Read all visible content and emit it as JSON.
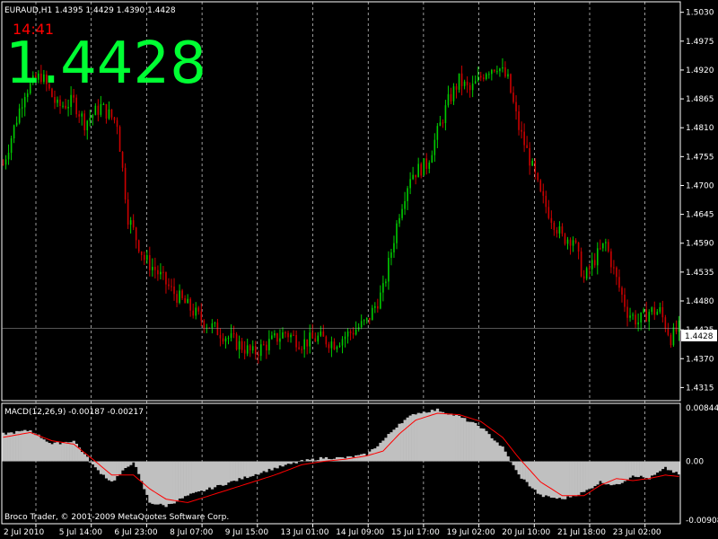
{
  "header": {
    "ohlc_label": "EURAUD,H1  1.4395 1.4429 1.4390 1.4428",
    "clock": "14:41",
    "big_price": "1.4428",
    "current_price_tag": "1.4428"
  },
  "footer": {
    "copyright": "Broco Trader, © 2001-2009 MetaQuotes Software Corp."
  },
  "colors": {
    "background": "#000000",
    "bull": "#00cc00",
    "bear": "#cc0000",
    "macd_hist": "#c0c0c0",
    "signal": "#ff0000",
    "big_price": "#00ff33",
    "clock": "#ff0000",
    "grid": "#ffffff"
  },
  "chart_data": [
    {
      "type": "candlestick",
      "symbol": "EURAUD",
      "timeframe": "H1",
      "ylim": [
        1.429,
        1.505
      ],
      "y_ticks": [
        "1.5030",
        "1.4975",
        "1.4920",
        "1.4865",
        "1.4810",
        "1.4755",
        "1.4700",
        "1.4645",
        "1.4590",
        "1.4535",
        "1.4480",
        "1.4425",
        "1.4370",
        "1.4315"
      ],
      "x_ticks": [
        "2 Jul 2010",
        "5 Jul 14:00",
        "6 Jul 23:00",
        "8 Jul 07:00",
        "9 Jul 15:00",
        "13 Jul 01:00",
        "14 Jul 09:00",
        "15 Jul 17:00",
        "19 Jul 02:00",
        "20 Jul 10:00",
        "21 Jul 18:00",
        "23 Jul 02:00"
      ],
      "current_price": 1.4428,
      "close_path": [
        [
          0,
          1.474
        ],
        [
          8,
          1.488
        ],
        [
          14,
          1.491
        ],
        [
          20,
          1.485
        ],
        [
          26,
          1.486
        ],
        [
          30,
          1.482
        ],
        [
          36,
          1.485
        ],
        [
          42,
          1.482
        ],
        [
          46,
          1.464
        ],
        [
          52,
          1.456
        ],
        [
          56,
          1.454
        ],
        [
          62,
          1.45
        ],
        [
          68,
          1.447
        ],
        [
          74,
          1.444
        ],
        [
          80,
          1.442
        ],
        [
          86,
          1.44
        ],
        [
          92,
          1.438
        ],
        [
          98,
          1.44
        ],
        [
          104,
          1.442
        ],
        [
          110,
          1.44
        ],
        [
          116,
          1.441
        ],
        [
          122,
          1.44
        ],
        [
          128,
          1.442
        ],
        [
          134,
          1.444
        ],
        [
          140,
          1.45
        ],
        [
          146,
          1.465
        ],
        [
          150,
          1.472
        ],
        [
          156,
          1.474
        ],
        [
          160,
          1.48
        ],
        [
          164,
          1.486
        ],
        [
          168,
          1.49
        ],
        [
          172,
          1.488
        ],
        [
          178,
          1.492
        ],
        [
          182,
          1.493
        ],
        [
          186,
          1.49
        ],
        [
          190,
          1.481
        ],
        [
          194,
          1.475
        ],
        [
          198,
          1.468
        ],
        [
          202,
          1.464
        ],
        [
          206,
          1.46
        ],
        [
          210,
          1.46
        ],
        [
          214,
          1.452
        ],
        [
          218,
          1.456
        ],
        [
          222,
          1.459
        ],
        [
          226,
          1.452
        ],
        [
          230,
          1.446
        ],
        [
          234,
          1.444
        ],
        [
          238,
          1.446
        ],
        [
          242,
          1.446
        ],
        [
          246,
          1.441
        ],
        [
          249,
          1.4428
        ]
      ],
      "bars": 250
    },
    {
      "type": "macd",
      "label": "MACD(12,26,9) -0.00187 -0.00217",
      "ylim": [
        -0.00908,
        0.00844
      ],
      "y_ticks": [
        "0.00844",
        "0.00",
        "-0.00908"
      ],
      "histogram_path": [
        [
          0,
          0.004
        ],
        [
          10,
          0.0045
        ],
        [
          18,
          0.0025
        ],
        [
          26,
          0.003
        ],
        [
          34,
          -0.001
        ],
        [
          40,
          -0.003
        ],
        [
          48,
          0.0
        ],
        [
          54,
          -0.006
        ],
        [
          60,
          -0.0065
        ],
        [
          68,
          -0.005
        ],
        [
          76,
          -0.004
        ],
        [
          84,
          -0.003
        ],
        [
          92,
          -0.002
        ],
        [
          100,
          -0.001
        ],
        [
          110,
          0.0
        ],
        [
          118,
          0.0005
        ],
        [
          126,
          0.0005
        ],
        [
          134,
          0.001
        ],
        [
          140,
          0.003
        ],
        [
          146,
          0.0055
        ],
        [
          152,
          0.007
        ],
        [
          160,
          0.0075
        ],
        [
          168,
          0.0065
        ],
        [
          176,
          0.005
        ],
        [
          184,
          0.002
        ],
        [
          190,
          -0.002
        ],
        [
          198,
          -0.005
        ],
        [
          206,
          -0.0055
        ],
        [
          214,
          -0.0045
        ],
        [
          220,
          -0.003
        ],
        [
          226,
          -0.0035
        ],
        [
          232,
          -0.002
        ],
        [
          238,
          -0.0025
        ],
        [
          244,
          -0.001
        ],
        [
          249,
          -0.0019
        ]
      ],
      "signal_path": [
        [
          0,
          0.0035
        ],
        [
          10,
          0.0042
        ],
        [
          18,
          0.003
        ],
        [
          26,
          0.0025
        ],
        [
          34,
          0.0
        ],
        [
          40,
          -0.002
        ],
        [
          48,
          -0.002
        ],
        [
          54,
          -0.004
        ],
        [
          60,
          -0.0055
        ],
        [
          68,
          -0.006
        ],
        [
          76,
          -0.005
        ],
        [
          84,
          -0.004
        ],
        [
          92,
          -0.003
        ],
        [
          100,
          -0.002
        ],
        [
          110,
          -0.0005
        ],
        [
          118,
          0.0
        ],
        [
          126,
          0.0003
        ],
        [
          134,
          0.0008
        ],
        [
          140,
          0.0015
        ],
        [
          146,
          0.004
        ],
        [
          152,
          0.006
        ],
        [
          160,
          0.007
        ],
        [
          168,
          0.0068
        ],
        [
          176,
          0.0058
        ],
        [
          184,
          0.0035
        ],
        [
          190,
          0.0005
        ],
        [
          198,
          -0.003
        ],
        [
          206,
          -0.005
        ],
        [
          214,
          -0.005
        ],
        [
          220,
          -0.0035
        ],
        [
          226,
          -0.0025
        ],
        [
          232,
          -0.0028
        ],
        [
          238,
          -0.0025
        ],
        [
          244,
          -0.002
        ],
        [
          249,
          -0.0022
        ]
      ]
    }
  ]
}
